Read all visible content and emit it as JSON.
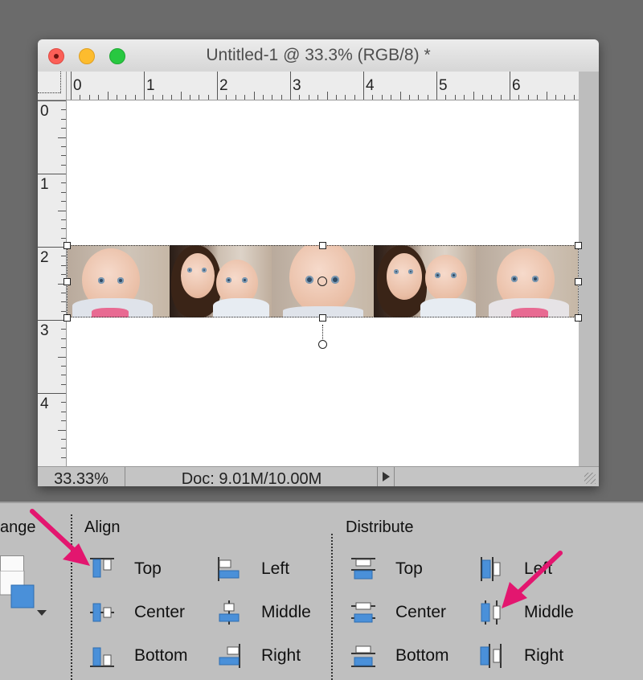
{
  "window": {
    "title": "Untitled-1 @ 33.3% (RGB/8) *"
  },
  "ruler": {
    "top_labels": [
      "0",
      "1",
      "2",
      "3",
      "4",
      "5",
      "6"
    ],
    "left_labels": [
      "0",
      "1",
      "2",
      "3",
      "4"
    ]
  },
  "statusbar": {
    "zoom": "33.33%",
    "doc_info": "Doc: 9.01M/10.00M"
  },
  "panel": {
    "arrange_heading": "ange",
    "align": {
      "heading": "Align",
      "options": [
        {
          "label": "Top",
          "icon": "align-top-edges-icon"
        },
        {
          "label": "Center",
          "icon": "align-vertical-centers-icon"
        },
        {
          "label": "Bottom",
          "icon": "align-bottom-edges-icon"
        },
        {
          "label": "Left",
          "icon": "align-left-edges-icon"
        },
        {
          "label": "Middle",
          "icon": "align-horizontal-centers-icon"
        },
        {
          "label": "Right",
          "icon": "align-right-edges-icon"
        }
      ]
    },
    "distribute": {
      "heading": "Distribute",
      "options": [
        {
          "label": "Top",
          "icon": "distribute-top-icon"
        },
        {
          "label": "Center",
          "icon": "distribute-vertical-centers-icon"
        },
        {
          "label": "Bottom",
          "icon": "distribute-bottom-icon"
        },
        {
          "label": "Left",
          "icon": "distribute-left-icon"
        },
        {
          "label": "Middle",
          "icon": "distribute-horizontal-centers-icon"
        },
        {
          "label": "Right",
          "icon": "distribute-right-icon"
        }
      ]
    }
  },
  "colors": {
    "callout_arrow": "#e3166f",
    "icon_blue": "#4a90d9",
    "close": "#fc5f57",
    "minimize": "#fdbc2e",
    "maximize": "#28c840"
  }
}
